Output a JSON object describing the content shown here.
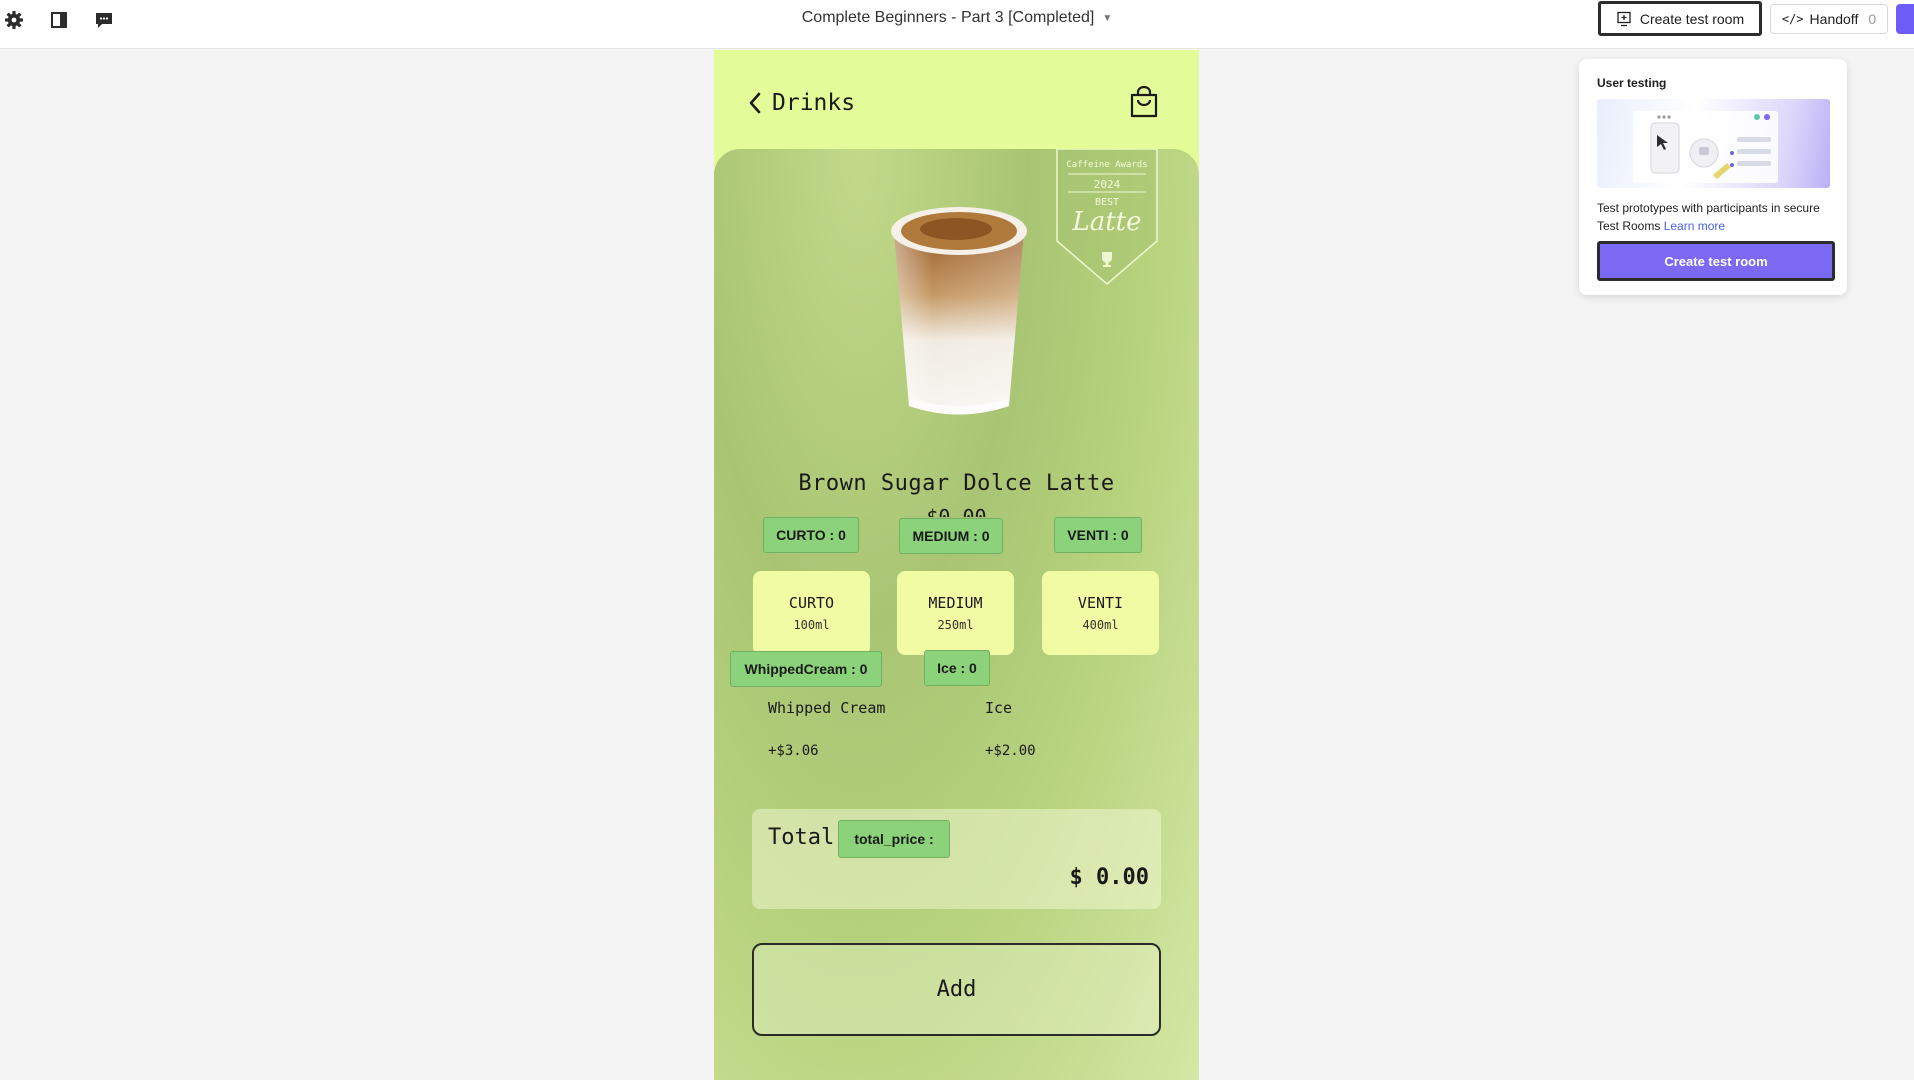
{
  "topbar": {
    "settings_icon": "gear-icon",
    "panel_icon": "sidebar-panel-icon",
    "comments_icon": "comment-icon",
    "file_title": "Complete Beginners - Part 3 [Completed]",
    "create_test_room": "Create test room",
    "handoff_label": "Handoff",
    "handoff_count": "0"
  },
  "phone": {
    "back_label": "Drinks",
    "award": {
      "line1": "Caffeine Awards",
      "year": "2024",
      "best": "BEST",
      "category": "Latte"
    },
    "product_name": "Brown Sugar Dolce Latte",
    "product_price": "$0.00",
    "variable_tags": {
      "curto": "CURTO : 0",
      "medium": "MEDIUM : 0",
      "venti": "VENTI : 0",
      "whipped_cream": "WhippedCream : 0",
      "ice": "Ice : 0",
      "total_price": "total_price :"
    },
    "sizes": [
      {
        "name": "CURTO",
        "volume": "100ml"
      },
      {
        "name": "MEDIUM",
        "volume": "250ml"
      },
      {
        "name": "VENTI",
        "volume": "400ml"
      }
    ],
    "addons": [
      {
        "name": "Whipped Cream",
        "price": "+$3.06"
      },
      {
        "name": "Ice",
        "price": "+$2.00"
      }
    ],
    "total_label": "Total",
    "total_amount": "$ 0.00",
    "add_button": "Add"
  },
  "user_testing": {
    "title": "User testing",
    "description": "Test prototypes with participants in secure Test Rooms",
    "learn_more": "Learn more",
    "create_button": "Create test room"
  },
  "colors": {
    "phone_bg": "#e3fb98",
    "size_option_bg": "#f1fba4",
    "variable_tag_bg": "#8cd27a",
    "accent_purple": "#7b68f3"
  }
}
